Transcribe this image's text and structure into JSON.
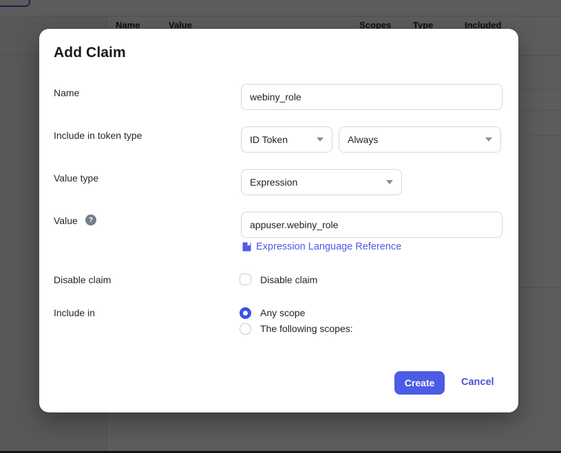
{
  "background": {
    "table": {
      "columns": [
        "Name",
        "Value",
        "Scopes",
        "Type",
        "Included"
      ]
    }
  },
  "modal": {
    "title": "Add Claim",
    "fields": {
      "name": {
        "label": "Name",
        "value": "webiny_role"
      },
      "token_type": {
        "label": "Include in token type",
        "selects": [
          {
            "value": "ID Token"
          },
          {
            "value": "Always"
          }
        ]
      },
      "value_type": {
        "label": "Value type",
        "value": "Expression"
      },
      "value": {
        "label": "Value",
        "help_icon": "question-mark",
        "value": "appuser.webiny_role",
        "reference_link": "Expression Language Reference"
      },
      "disable_claim": {
        "label": "Disable claim",
        "checkbox_label": "Disable claim",
        "checked": false
      },
      "include_in": {
        "label": "Include in",
        "options": [
          {
            "label": "Any scope",
            "selected": true
          },
          {
            "label": "The following scopes:",
            "selected": false
          }
        ]
      }
    },
    "buttons": {
      "create": "Create",
      "cancel": "Cancel"
    },
    "colors": {
      "accent": "#4c5ce4",
      "radio_selected": "#3d53e6",
      "overlay": "rgba(0,0,0,0.64)"
    }
  }
}
